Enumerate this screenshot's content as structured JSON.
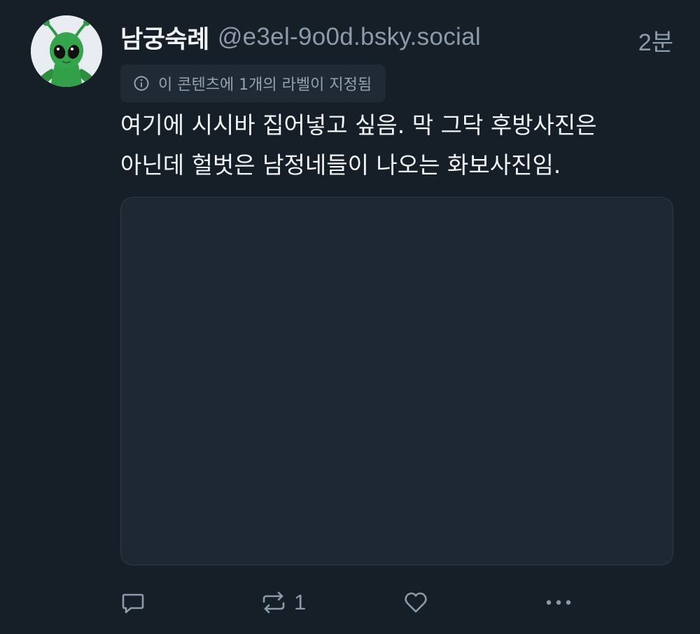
{
  "post": {
    "author": {
      "display_name": "남궁숙례",
      "handle": "@e3el-9o0d.bsky.social"
    },
    "timestamp": "2분",
    "content_label": {
      "icon": "info-circle-icon",
      "text": "이 콘텐츠에 1개의 라벨이 지정됨"
    },
    "text_line_1": "여기에 시시바 집어넣고 싶음. 막 그닥 후방사진은",
    "text_line_2": "아닌데 헐벗은 남정네들이 나오는 화보사진임.",
    "actions": {
      "reply": {
        "icon": "reply-icon",
        "count": ""
      },
      "repost": {
        "icon": "repost-icon",
        "count": "1"
      },
      "like": {
        "icon": "heart-icon",
        "count": ""
      },
      "more": {
        "icon": "more-horizontal-icon"
      }
    }
  },
  "colors": {
    "background": "#161e27",
    "text_primary": "#f1f3f5",
    "text_secondary": "#8c9bab",
    "pill_background": "#1f2a35",
    "media_background": "#1e2833",
    "avatar_green": "#2f9a44"
  }
}
